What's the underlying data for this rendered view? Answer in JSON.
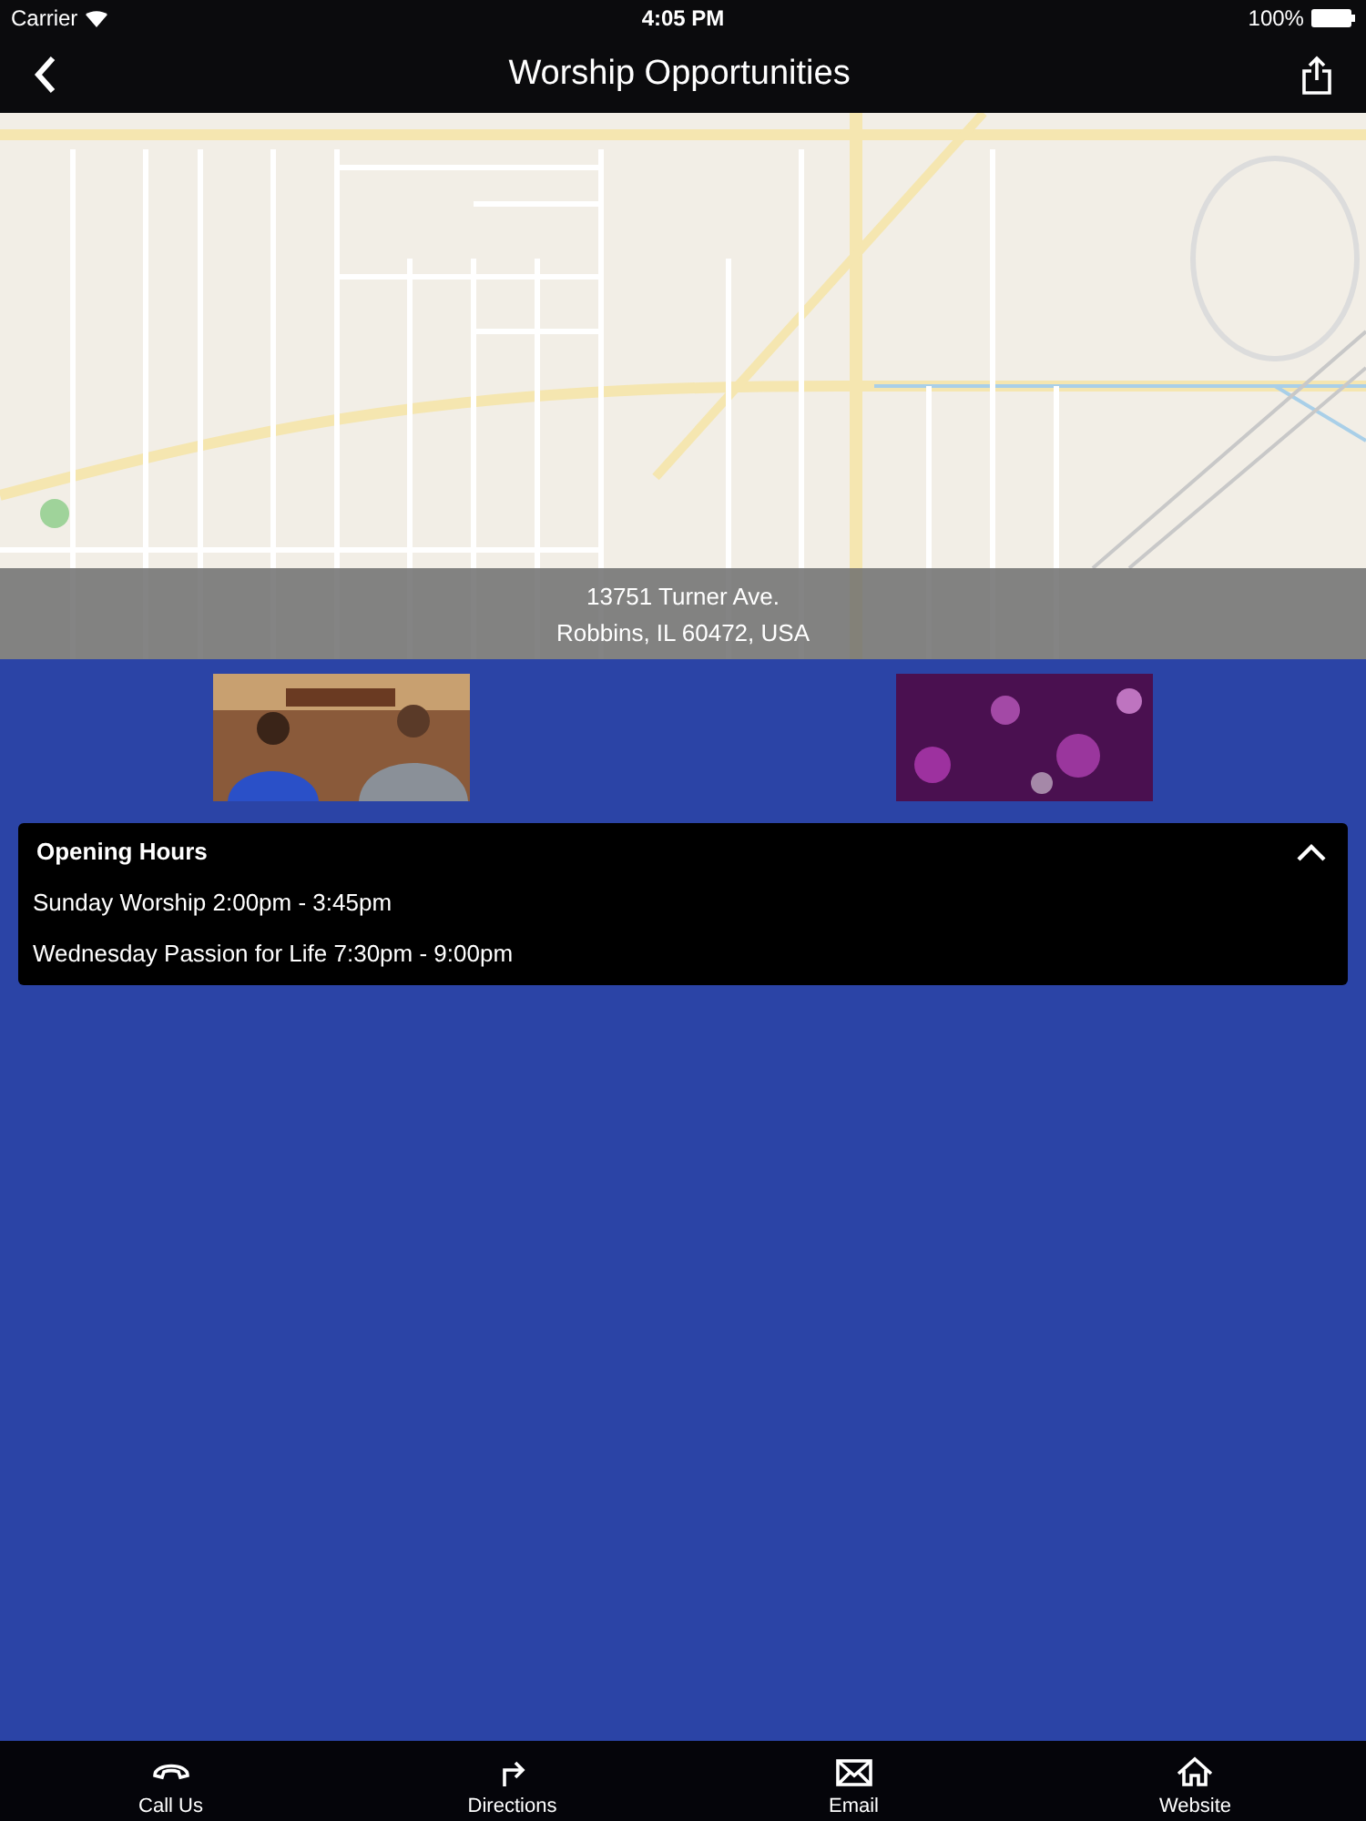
{
  "status_bar": {
    "carrier": "Carrier",
    "time": "4:05 PM",
    "battery": "100%"
  },
  "nav_bar": {
    "title": "Worship Opportunities"
  },
  "map": {
    "kind": "picture",
    "address_lines": [
      "13751 Turner Ave.",
      "Robbins, IL 60472, USA"
    ]
  },
  "opening_hours": {
    "title": "Opening Hours",
    "expanded": true,
    "rows": [
      "Sunday Worship 2:00pm - 3:45pm",
      "Wednesday Passion for Life 7:30pm - 9:00pm"
    ]
  },
  "tab_bar": [
    {
      "kind": "phone",
      "label": "Call Us"
    },
    {
      "kind": "directions",
      "label": "Directions"
    },
    {
      "kind": "email",
      "label": "Email"
    },
    {
      "kind": "home",
      "label": "Website"
    }
  ]
}
